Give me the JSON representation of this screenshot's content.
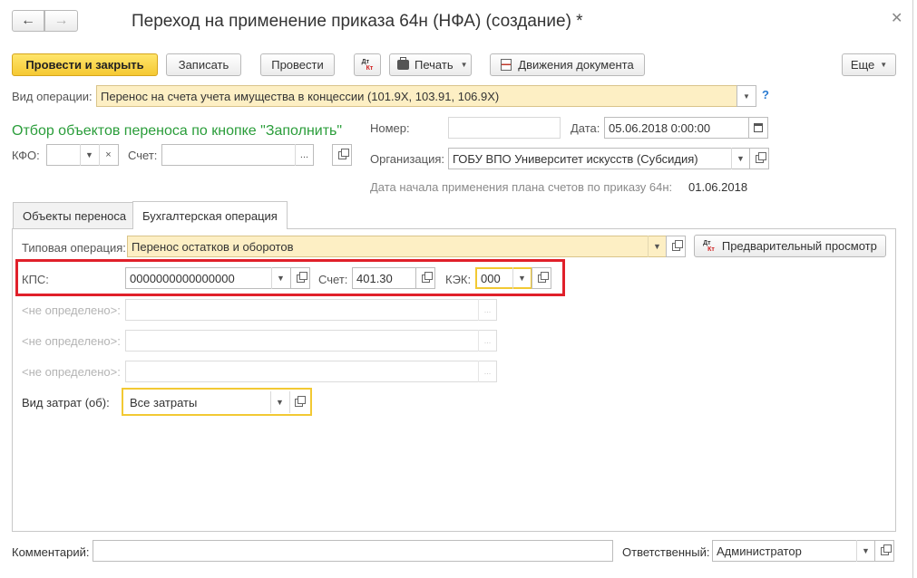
{
  "window": {
    "title": "Переход на применение приказа 64н (НФА) (создание) *"
  },
  "toolbar": {
    "post_close": "Провести и закрыть",
    "save": "Записать",
    "post": "Провести",
    "print": "Печать",
    "movements": "Движения документа",
    "more": "Еще"
  },
  "header": {
    "operation_label": "Вид операции:",
    "operation_value": "Перенос на счета учета имущества в концессии (101.9Х, 103.91, 106.9Х)",
    "help": "?",
    "filter_caption": "Отбор объектов переноса по кнопке \"Заполнить\"",
    "kfo_label": "КФО:",
    "kfo_value": "",
    "account_label": "Счет:",
    "account_value": "",
    "number_label": "Номер:",
    "number_value": "",
    "date_label": "Дата:",
    "date_value": "05.06.2018  0:00:00",
    "org_label": "Организация:",
    "org_value": "ГОБУ ВПО Университет искусств (Субсидия)",
    "plan_date_label": "Дата начала применения плана счетов по приказу 64н:",
    "plan_date_value": "01.06.2018"
  },
  "tabs": [
    {
      "label": "Объекты переноса"
    },
    {
      "label": "Бухгалтерская операция"
    }
  ],
  "operation": {
    "typical_label": "Типовая операция:",
    "typical_value": "Перенос остатков и оборотов",
    "preview": "Предварительный просмотр",
    "kps_label": "КПС:",
    "kps_value": "0000000000000000",
    "acc_label": "Счет:",
    "acc_value": "401.30",
    "kek_label": "КЭК:",
    "kek_value": "000",
    "undefined1": "<не определено>:",
    "undefined2": "<не определено>:",
    "undefined3": "<не определено>:",
    "cost_label": "Вид затрат (об):",
    "cost_value": "Все затраты"
  },
  "footer": {
    "comment_label": "Комментарий:",
    "comment_value": "",
    "responsible_label": "Ответственный:",
    "responsible_value": "Администратор"
  },
  "colors": {
    "primary_button": "#f5c933",
    "caption_green": "#2a9d3a",
    "highlight_red": "#e0202a",
    "focus_yellow": "#f2c933"
  }
}
